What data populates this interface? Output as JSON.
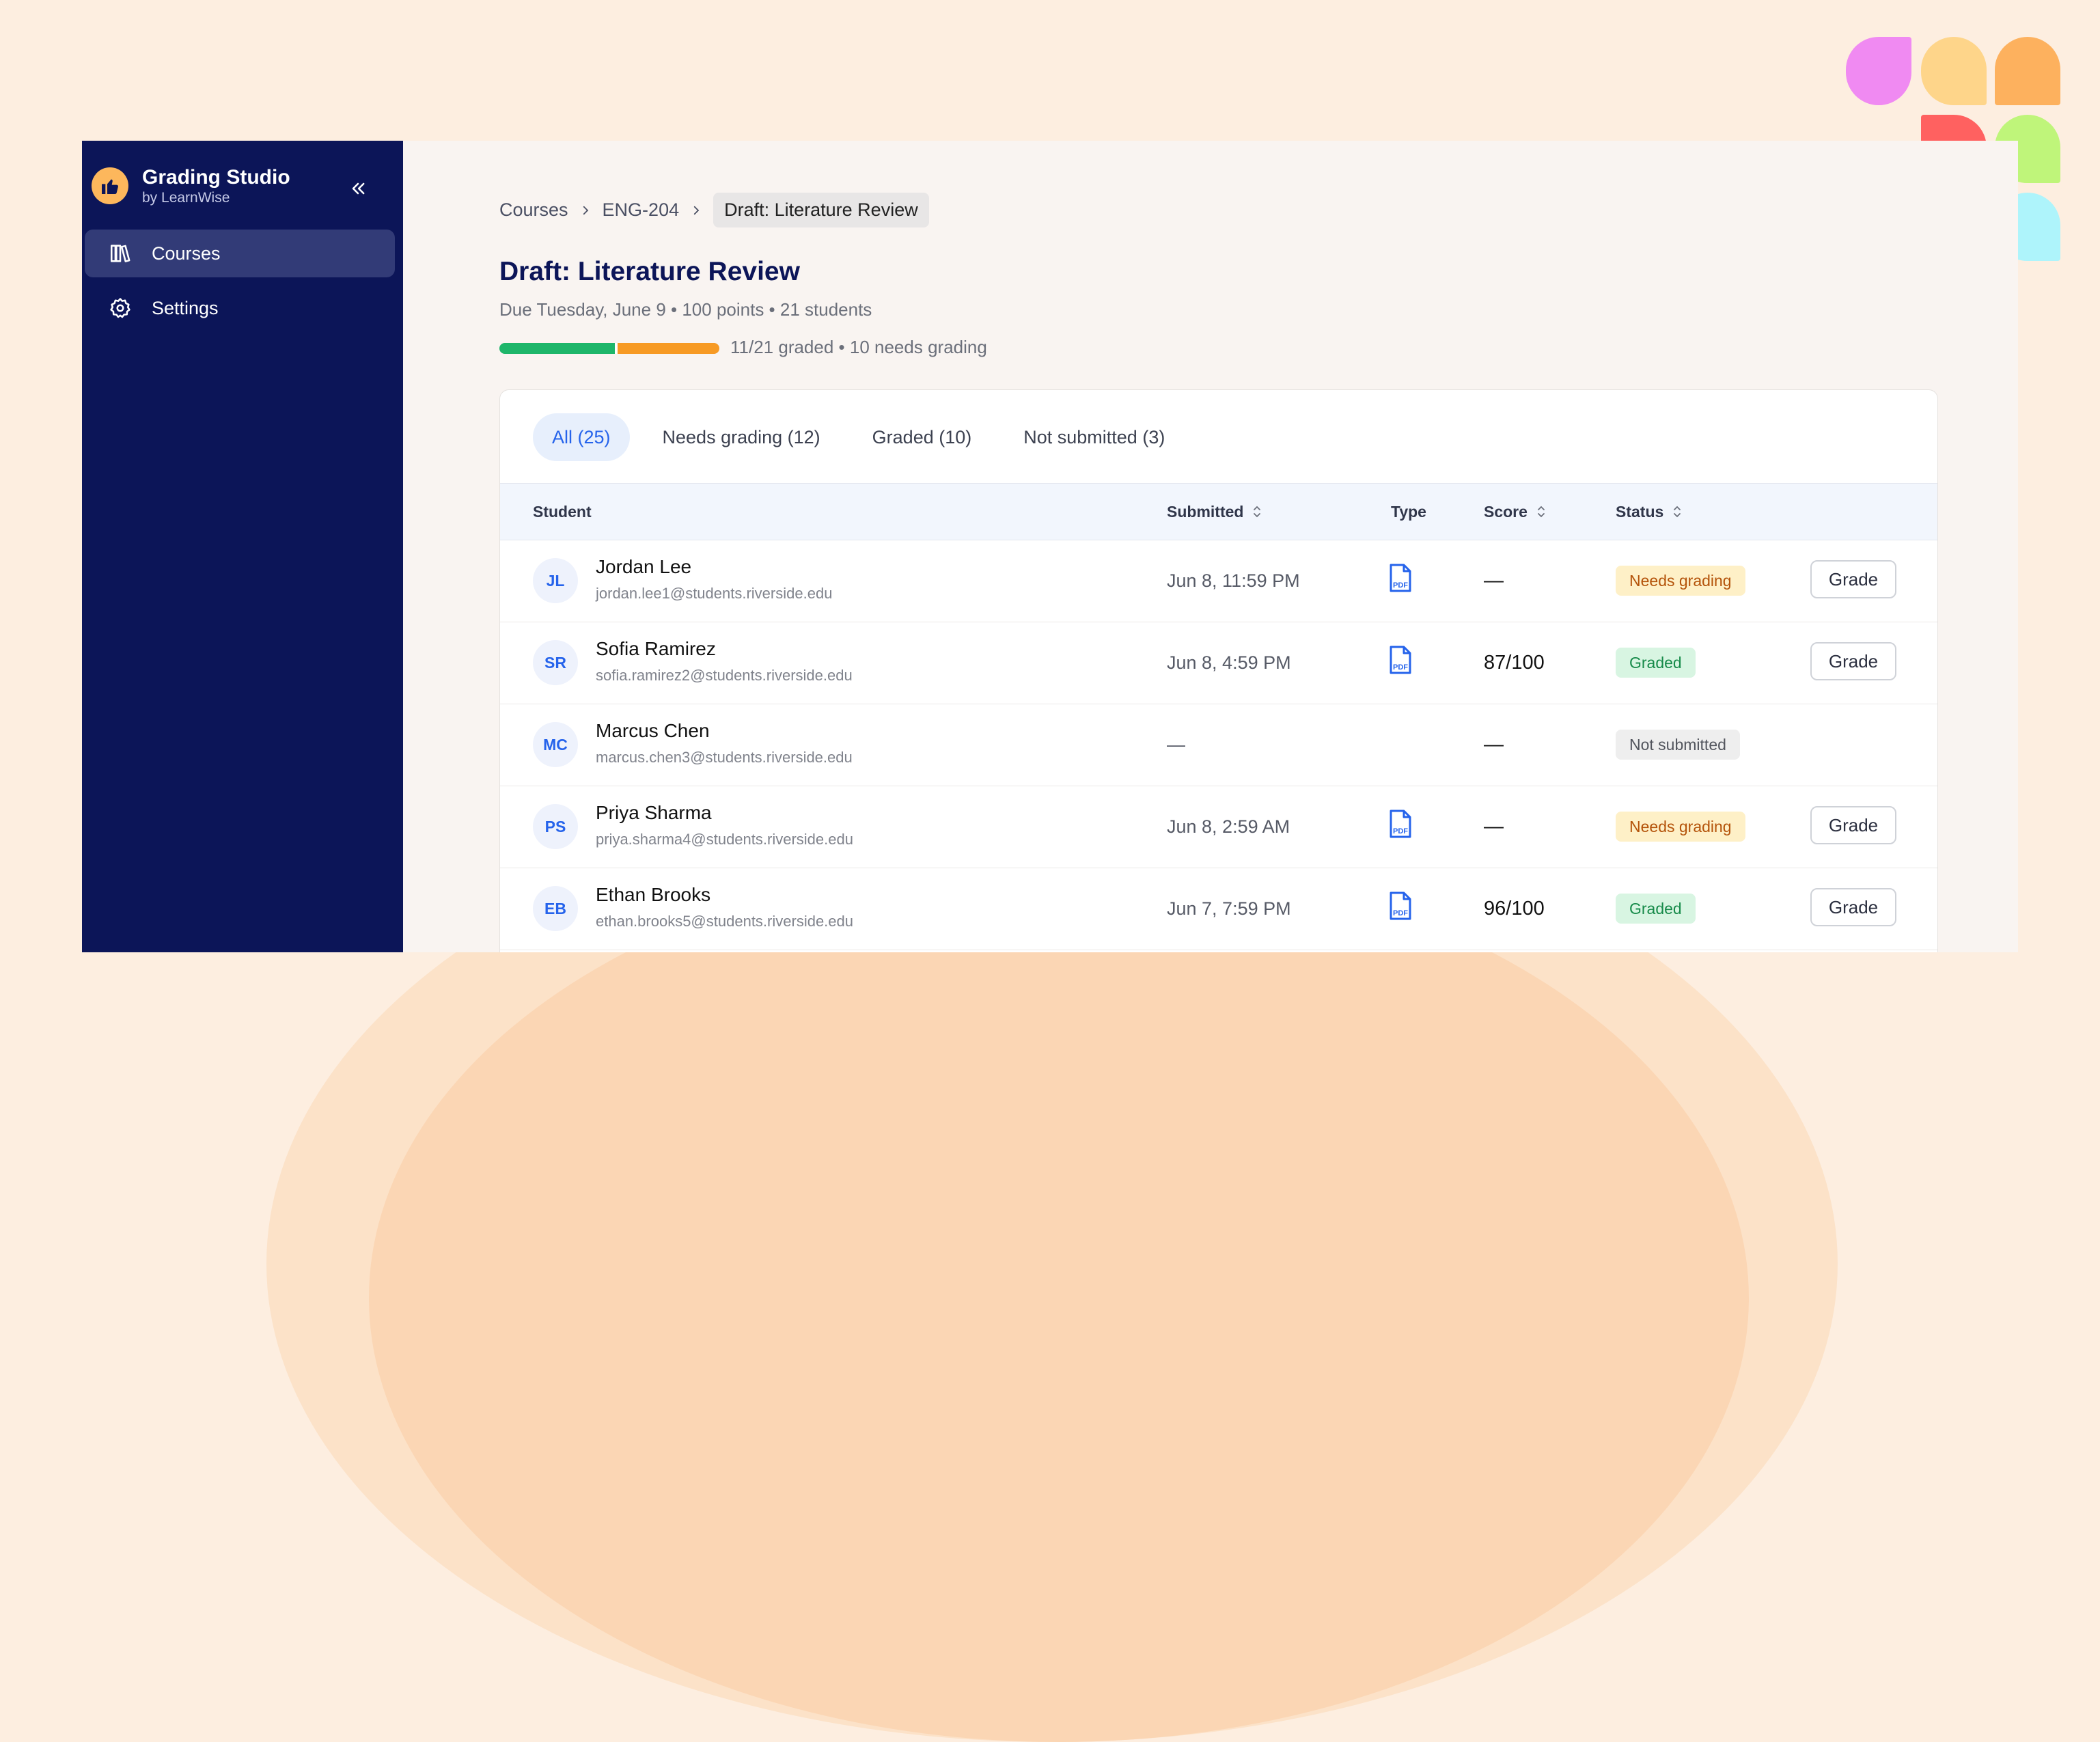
{
  "app": {
    "name": "Grading Studio",
    "byline": "by LearnWise"
  },
  "sidebar": {
    "items": [
      {
        "label": "Courses",
        "icon": "books-icon",
        "active": true
      },
      {
        "label": "Settings",
        "icon": "gear-icon",
        "active": false
      }
    ]
  },
  "breadcrumb": [
    "Courses",
    "ENG-204",
    "Draft: Literature Review"
  ],
  "assignment": {
    "title": "Draft: Literature Review",
    "subtitle": "Due Tuesday, June 9 • 100 points • 21 students",
    "progress_text": "11/21 graded • 10 needs grading",
    "graded_fraction": 0.524
  },
  "tabs": [
    {
      "label": "All (25)",
      "active": true
    },
    {
      "label": "Needs grading (12)",
      "active": false
    },
    {
      "label": "Graded (10)",
      "active": false
    },
    {
      "label": "Not submitted (3)",
      "active": false
    }
  ],
  "table": {
    "columns": [
      "Student",
      "Submitted",
      "Type",
      "Score",
      "Status"
    ],
    "grade_label": "Grade",
    "rows": [
      {
        "initials": "JL",
        "name": "Jordan Lee",
        "email": "jordan.lee1@students.riverside.edu",
        "submitted": "Jun 8, 11:59 PM",
        "type": "pdf",
        "score": "—",
        "status": "Needs grading"
      },
      {
        "initials": "SR",
        "name": "Sofia Ramirez",
        "email": "sofia.ramirez2@students.riverside.edu",
        "submitted": "Jun 8, 4:59 PM",
        "type": "pdf",
        "score": "87/100",
        "status": "Graded"
      },
      {
        "initials": "MC",
        "name": "Marcus Chen",
        "email": "marcus.chen3@students.riverside.edu",
        "submitted": "—",
        "type": "",
        "score": "—",
        "status": "Not submitted"
      },
      {
        "initials": "PS",
        "name": "Priya Sharma",
        "email": "priya.sharma4@students.riverside.edu",
        "submitted": "Jun 8, 2:59 AM",
        "type": "pdf",
        "score": "—",
        "status": "Needs grading"
      },
      {
        "initials": "EB",
        "name": "Ethan Brooks",
        "email": "ethan.brooks5@students.riverside.edu",
        "submitted": "Jun 7, 7:59 PM",
        "type": "pdf",
        "score": "96/100",
        "status": "Graded"
      }
    ]
  },
  "colors": {
    "sidebar": "#0c1558",
    "accent": "#2563eb",
    "progress_graded": "#1eb66a",
    "progress_pending": "#f79a24"
  }
}
